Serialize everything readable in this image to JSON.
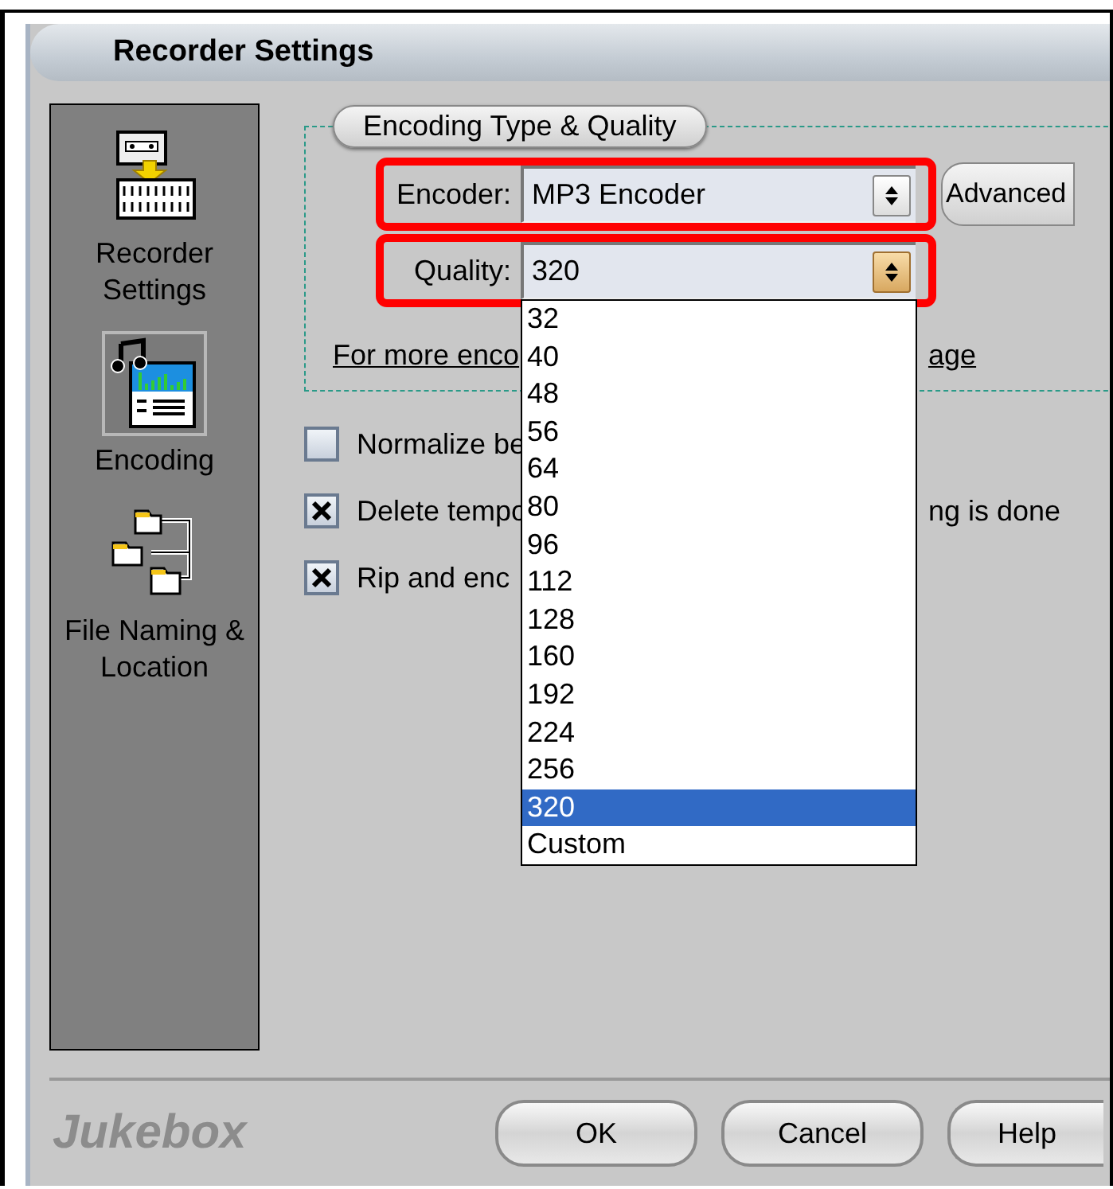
{
  "window": {
    "title": "Recorder Settings"
  },
  "sidebar": {
    "items": [
      {
        "label": "Recorder Settings",
        "selected": false
      },
      {
        "label": "Encoding",
        "selected": true
      },
      {
        "label": "File Naming & Location",
        "selected": false
      }
    ]
  },
  "encoding_group": {
    "legend": "Encoding Type & Quality",
    "encoder": {
      "label": "Encoder:",
      "value": "MP3 Encoder",
      "highlighted": true,
      "open": false
    },
    "advanced_button": "Advanced",
    "quality": {
      "label": "Quality:",
      "value": "320",
      "highlighted": true,
      "open": true,
      "options": [
        {
          "label": "32",
          "selected": false
        },
        {
          "label": "40",
          "selected": false
        },
        {
          "label": "48",
          "selected": false
        },
        {
          "label": "56",
          "selected": false
        },
        {
          "label": "64",
          "selected": false
        },
        {
          "label": "80",
          "selected": false
        },
        {
          "label": "96",
          "selected": false
        },
        {
          "label": "112",
          "selected": false
        },
        {
          "label": "128",
          "selected": false
        },
        {
          "label": "160",
          "selected": false
        },
        {
          "label": "192",
          "selected": false
        },
        {
          "label": "224",
          "selected": false
        },
        {
          "label": "256",
          "selected": false
        },
        {
          "label": "320",
          "selected": true
        },
        {
          "label": "Custom",
          "selected": false
        }
      ]
    },
    "link": {
      "text_start": "For more enco",
      "text_end": "age"
    }
  },
  "checkboxes": [
    {
      "text_start": "Normalize be",
      "checked": false
    },
    {
      "text_start": "Delete tempo",
      "text_end": "ng is done",
      "checked": true
    },
    {
      "text_start": "Rip and enc",
      "checked": true
    }
  ],
  "footer": {
    "logo": "Jukebox",
    "buttons": [
      "OK",
      "Cancel",
      "Help"
    ]
  }
}
